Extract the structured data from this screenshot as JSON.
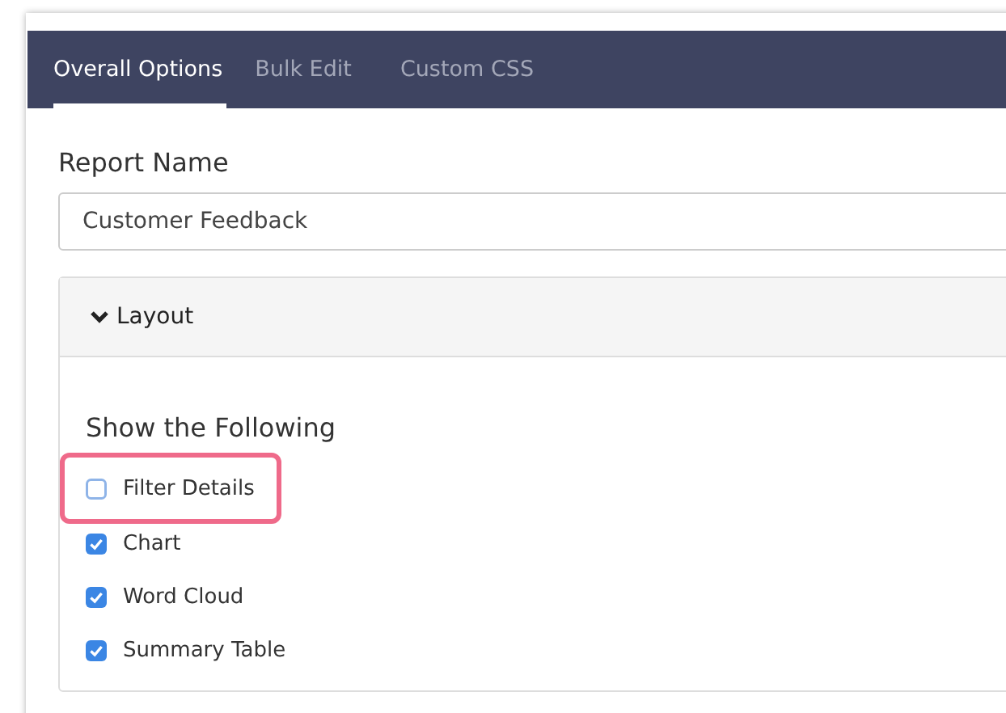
{
  "tabs": [
    {
      "label": "Overall Options",
      "selected": true
    },
    {
      "label": "Bulk Edit",
      "selected": false
    },
    {
      "label": "Custom CSS",
      "selected": false
    }
  ],
  "report_name": {
    "label": "Report Name",
    "value": "Customer Feedback"
  },
  "layout_section": {
    "title": "Layout",
    "expanded": true,
    "heading": "Show the Following",
    "options": [
      {
        "label": "Filter Details",
        "checked": false,
        "highlighted": true
      },
      {
        "label": "Chart",
        "checked": true,
        "highlighted": false
      },
      {
        "label": "Word Cloud",
        "checked": true,
        "highlighted": false
      },
      {
        "label": "Summary Table",
        "checked": true,
        "highlighted": false
      }
    ]
  }
}
